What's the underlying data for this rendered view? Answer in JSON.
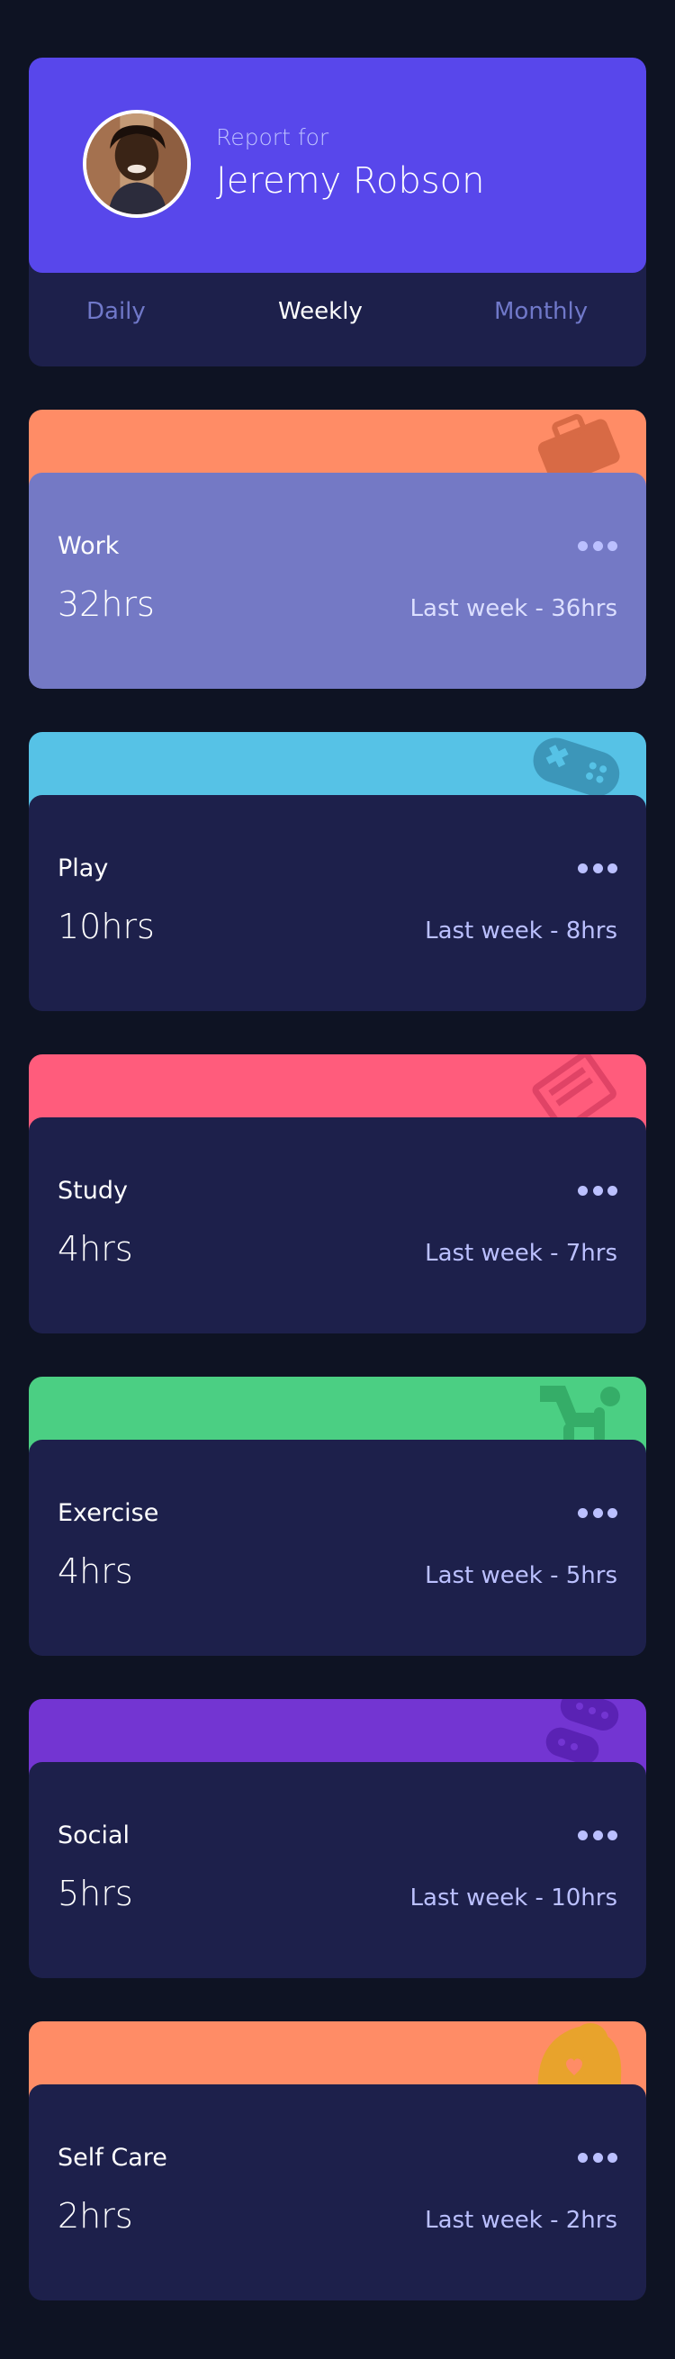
{
  "profile": {
    "report_label": "Report for",
    "name": "Jeremy Robson"
  },
  "tabs": [
    {
      "label": "Daily",
      "active": false
    },
    {
      "label": "Weekly",
      "active": true
    },
    {
      "label": "Monthly",
      "active": false
    }
  ],
  "activities": [
    {
      "title": "Work",
      "current": "32hrs",
      "previous": "Last week - 36hrs",
      "color": "#ff8c66",
      "icon": "briefcase-icon"
    },
    {
      "title": "Play",
      "current": "10hrs",
      "previous": "Last week - 8hrs",
      "color": "#56c2e6",
      "icon": "gamepad-icon"
    },
    {
      "title": "Study",
      "current": "4hrs",
      "previous": "Last week - 7hrs",
      "color": "#ff5c7c",
      "icon": "book-icon"
    },
    {
      "title": "Exercise",
      "current": "4hrs",
      "previous": "Last week - 5hrs",
      "color": "#4bcf83",
      "icon": "runner-icon"
    },
    {
      "title": "Social",
      "current": "5hrs",
      "previous": "Last week - 10hrs",
      "color": "#7335d2",
      "icon": "chat-icon"
    },
    {
      "title": "Self Care",
      "current": "2hrs",
      "previous": "Last week - 2hrs",
      "color": "#f1c75b",
      "icon": "heart-icon"
    }
  ]
}
